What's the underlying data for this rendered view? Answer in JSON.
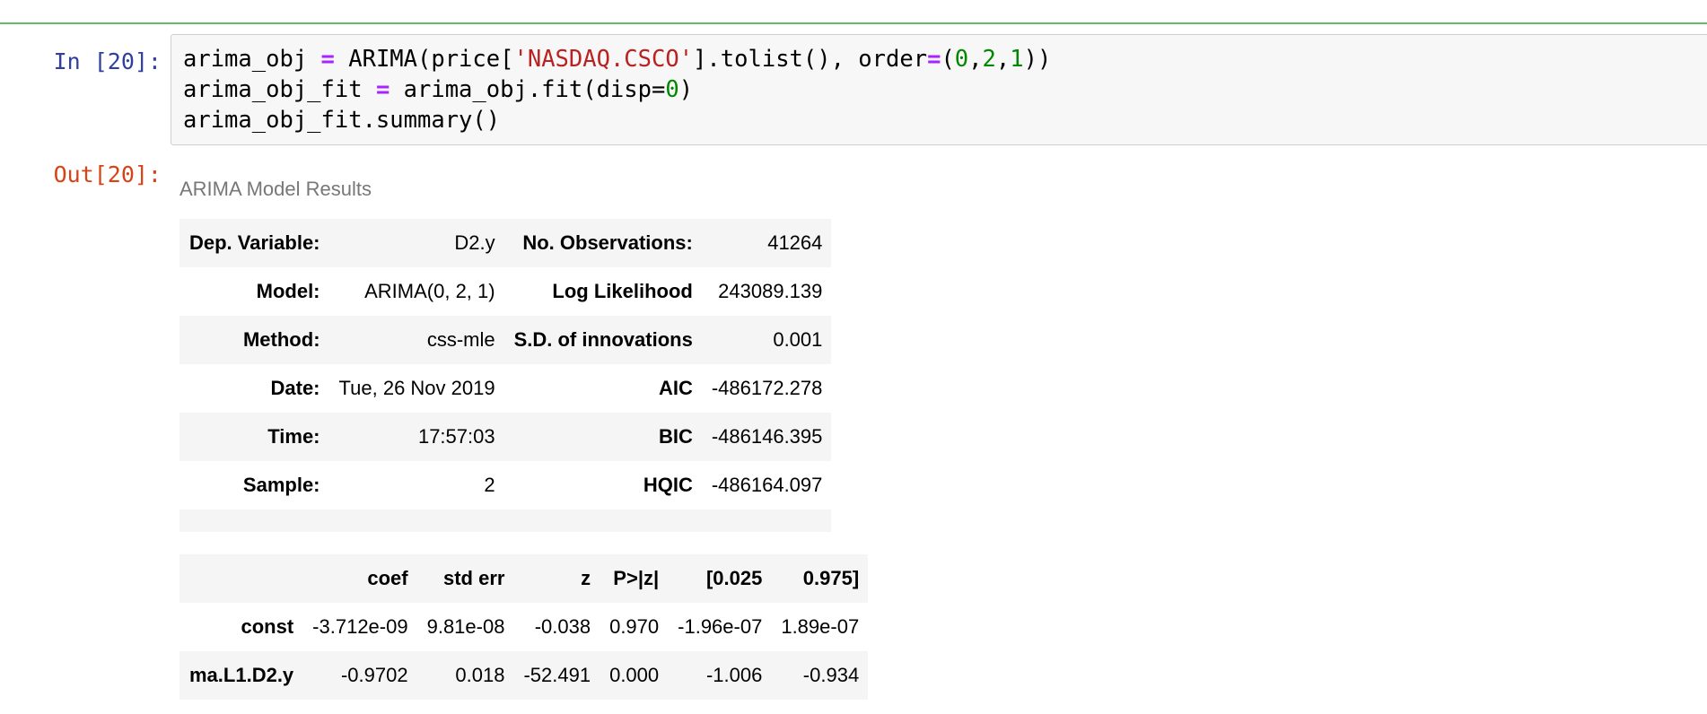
{
  "cell": {
    "in_prompt": "In [20]:",
    "out_prompt": "Out[20]:",
    "code_lines": [
      "arima_obj = ARIMA(price['NASDAQ.CSCO'].tolist(), order=(0,2,1))",
      "arima_obj_fit = arima_obj.fit(disp=0)",
      "arima_obj_fit.summary()"
    ]
  },
  "summary": {
    "caption": "ARIMA Model Results",
    "table1": [
      [
        "Dep. Variable:",
        "D2.y",
        "No. Observations:",
        "41264"
      ],
      [
        "Model:",
        "ARIMA(0, 2, 1)",
        "Log Likelihood",
        "243089.139"
      ],
      [
        "Method:",
        "css-mle",
        "S.D. of innovations",
        "0.001"
      ],
      [
        "Date:",
        "Tue, 26 Nov 2019",
        "AIC",
        "-486172.278"
      ],
      [
        "Time:",
        "17:57:03",
        "BIC",
        "-486146.395"
      ],
      [
        "Sample:",
        "2",
        "HQIC",
        "-486164.097"
      ]
    ],
    "table2": {
      "headers": [
        "",
        "coef",
        "std err",
        "z",
        "P>|z|",
        "[0.025",
        "0.975]"
      ],
      "rows": [
        [
          "const",
          "-3.712e-09",
          "9.81e-08",
          "-0.038",
          "0.970",
          "-1.96e-07",
          "1.89e-07"
        ],
        [
          "ma.L1.D2.y",
          "-0.9702",
          "0.018",
          "-52.491",
          "0.000",
          "-1.006",
          "-0.934"
        ]
      ]
    }
  }
}
